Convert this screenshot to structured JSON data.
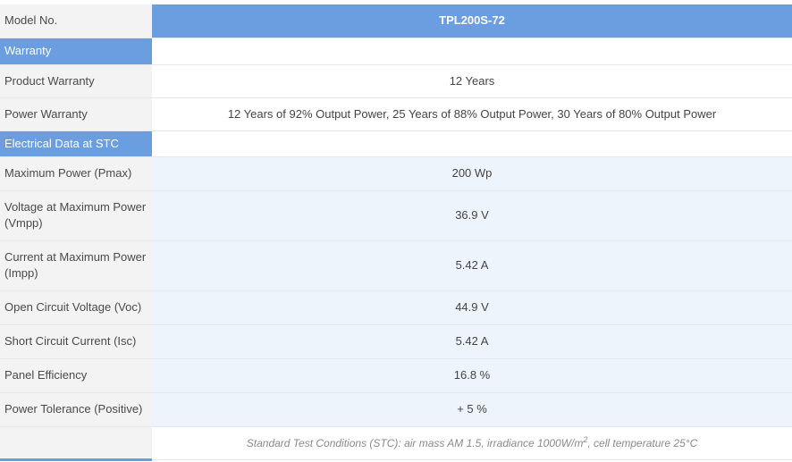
{
  "header": {
    "label": "Model No.",
    "model": "TPL200S-72"
  },
  "sections": {
    "warranty": {
      "title": "Warranty"
    },
    "electrical": {
      "title": "Electrical Data at STC"
    }
  },
  "rows": {
    "product_warranty": {
      "label": "Product Warranty",
      "value": "12 Years"
    },
    "power_warranty": {
      "label": "Power Warranty",
      "value": "12 Years of 92% Output Power, 25 Years of 88% Output Power, 30 Years of 80% Output Power"
    },
    "pmax": {
      "label": "Maximum Power (Pmax)",
      "value": "200 Wp"
    },
    "vmpp": {
      "label": "Voltage at Maximum Power (Vmpp)",
      "value": "36.9 V"
    },
    "impp": {
      "label": "Current at Maximum Power (Impp)",
      "value": "5.42 A"
    },
    "voc": {
      "label": "Open Circuit Voltage (Voc)",
      "value": "44.9 V"
    },
    "isc": {
      "label": "Short Circuit Current (Isc)",
      "value": "5.42 A"
    },
    "efficiency": {
      "label": "Panel Efficiency",
      "value": "16.8 %"
    },
    "tolerance": {
      "label": "Power Tolerance (Positive)",
      "value": "+ 5 %"
    }
  },
  "note": {
    "before": "Standard Test Conditions (STC): air mass AM 1.5, irradiance 1000W/m",
    "sup": "2",
    "after": ", cell temperature 25°C"
  },
  "colors": {
    "accent": "#6a9ee0",
    "alt_row": "#eef4fc",
    "label_bg": "#f3f3f3"
  }
}
